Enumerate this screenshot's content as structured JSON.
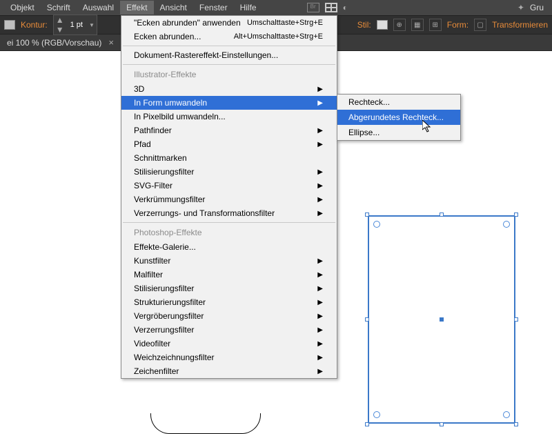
{
  "menubar": {
    "items": [
      "Objekt",
      "Schrift",
      "Auswahl",
      "Effekt",
      "Ansicht",
      "Fenster",
      "Hilfe"
    ],
    "active_index": 3,
    "right_label": "Gru"
  },
  "toolbar": {
    "kontur_label": "Kontur:",
    "stroke_value": "1 pt",
    "stil_label": "Stil:",
    "form_label": "Form:",
    "transform_label": "Transformieren"
  },
  "doctab": {
    "title": "ei 100 % (RGB/Vorschau)"
  },
  "effect_menu": {
    "apply_last": "\"Ecken abrunden\" anwenden",
    "apply_last_sc": "Umschalttaste+Strg+E",
    "round_corners": "Ecken abrunden...",
    "round_corners_sc": "Alt+Umschalttaste+Strg+E",
    "raster_settings": "Dokument-Rastereffekt-Einstellungen...",
    "header_illustrator": "Illustrator-Effekte",
    "items_ill": [
      "3D",
      "In Form umwandeln",
      "In Pixelbild umwandeln...",
      "Pathfinder",
      "Pfad",
      "Schnittmarken",
      "Stilisierungsfilter",
      "SVG-Filter",
      "Verkrümmungsfilter",
      "Verzerrungs- und Transformationsfilter"
    ],
    "items_ill_arrow": [
      true,
      true,
      false,
      true,
      true,
      false,
      true,
      true,
      true,
      true
    ],
    "ill_highlight_index": 1,
    "header_photoshop": "Photoshop-Effekte",
    "items_ps": [
      "Effekte-Galerie...",
      "Kunstfilter",
      "Malfilter",
      "Stilisierungsfilter",
      "Strukturierungsfilter",
      "Vergröberungsfilter",
      "Verzerrungsfilter",
      "Videofilter",
      "Weichzeichnungsfilter",
      "Zeichenfilter"
    ],
    "items_ps_arrow": [
      false,
      true,
      true,
      true,
      true,
      true,
      true,
      true,
      true,
      true
    ]
  },
  "submenu": {
    "items": [
      "Rechteck...",
      "Abgerundetes Rechteck...",
      "Ellipse..."
    ],
    "highlight_index": 1
  }
}
